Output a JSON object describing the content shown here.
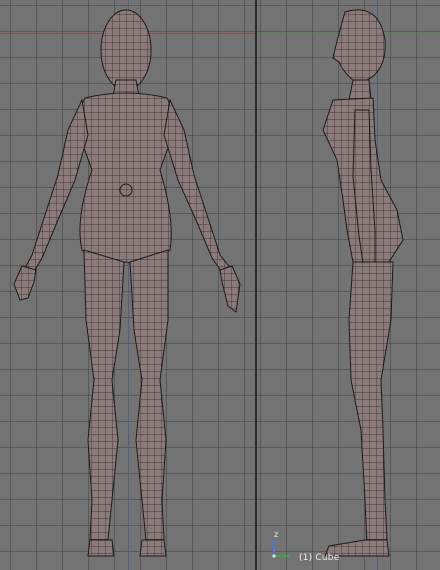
{
  "viewport_left": {
    "view": "front"
  },
  "viewport_right": {
    "view": "side"
  },
  "gizmo": {
    "axis_label": "z"
  },
  "status": {
    "object_label": "(1) Cube"
  },
  "colors": {
    "grid_bg": "#737373",
    "mesh_fill": "#8a7a7a",
    "wire": "#2a2525",
    "x_axis": "#8a4a4a",
    "y_axis": "#4d8a4d",
    "z_axis": "#4b5a85"
  },
  "icons": [
    "axis-gizmo-icon"
  ]
}
